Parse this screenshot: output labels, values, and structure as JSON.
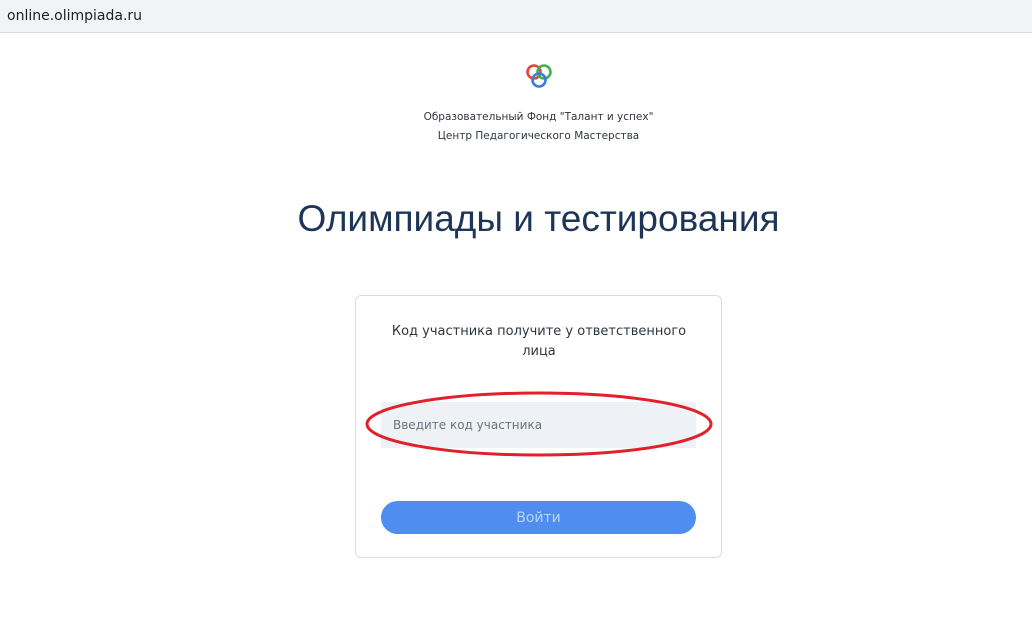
{
  "browser": {
    "url": "online.olimpiada.ru"
  },
  "header": {
    "logo_icon": "three-rings-logo-icon",
    "org_name": "Образовательный Фонд \"Талант и успех\"",
    "org_center": "Центр Педагогического Мастерства"
  },
  "main": {
    "title": "Олимпиады и тестирования"
  },
  "login_card": {
    "hint": "Код участника получите у ответственного лица",
    "code_input_value": "",
    "code_input_placeholder": "Введите код участника",
    "login_label": "Войти",
    "login_enabled": false
  },
  "colors": {
    "title": "#1d3557",
    "button": "#4f8ef0",
    "annotation": "#e0202a",
    "logo_red": "#e8433a",
    "logo_green": "#3fb34f",
    "logo_blue": "#3b7be0"
  }
}
